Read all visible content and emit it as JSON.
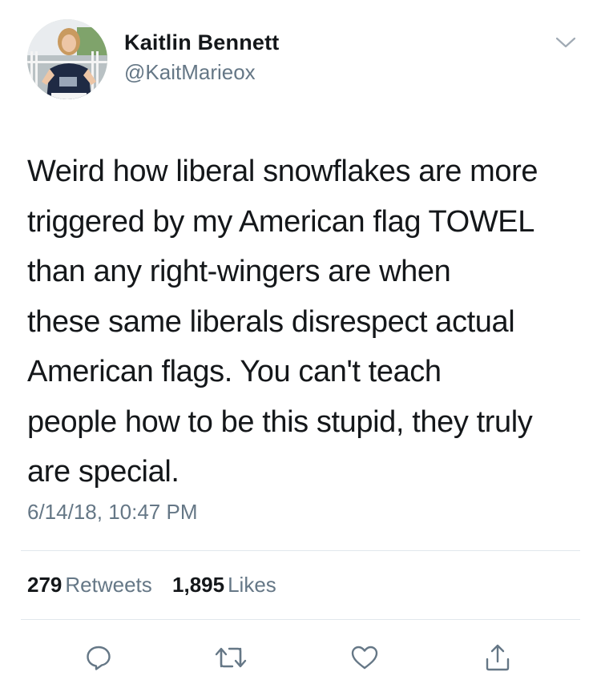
{
  "author": {
    "name": "Kaitlin Bennett",
    "handle": "@KaitMarieox",
    "avatar_icon": "profile-photo"
  },
  "tweet": {
    "text_lines": [
      "Weird how liberal snowflakes are more",
      "triggered by my American flag TOWEL",
      "than any right-wingers are when",
      "these same liberals disrespect actual",
      "American flags. You can't teach",
      "people how to be this stupid, they truly",
      "are special."
    ],
    "timestamp": "6/14/18, 10:47 PM"
  },
  "stats": {
    "retweets_count": "279",
    "retweets_label": "Retweets",
    "likes_count": "1,895",
    "likes_label": "Likes"
  },
  "actions": [
    "reply-icon",
    "retweet-icon",
    "like-icon",
    "share-icon"
  ],
  "colors": {
    "text_primary": "#14171a",
    "text_secondary": "#657786",
    "divider": "#e1e8ed",
    "icon": "#657786"
  }
}
